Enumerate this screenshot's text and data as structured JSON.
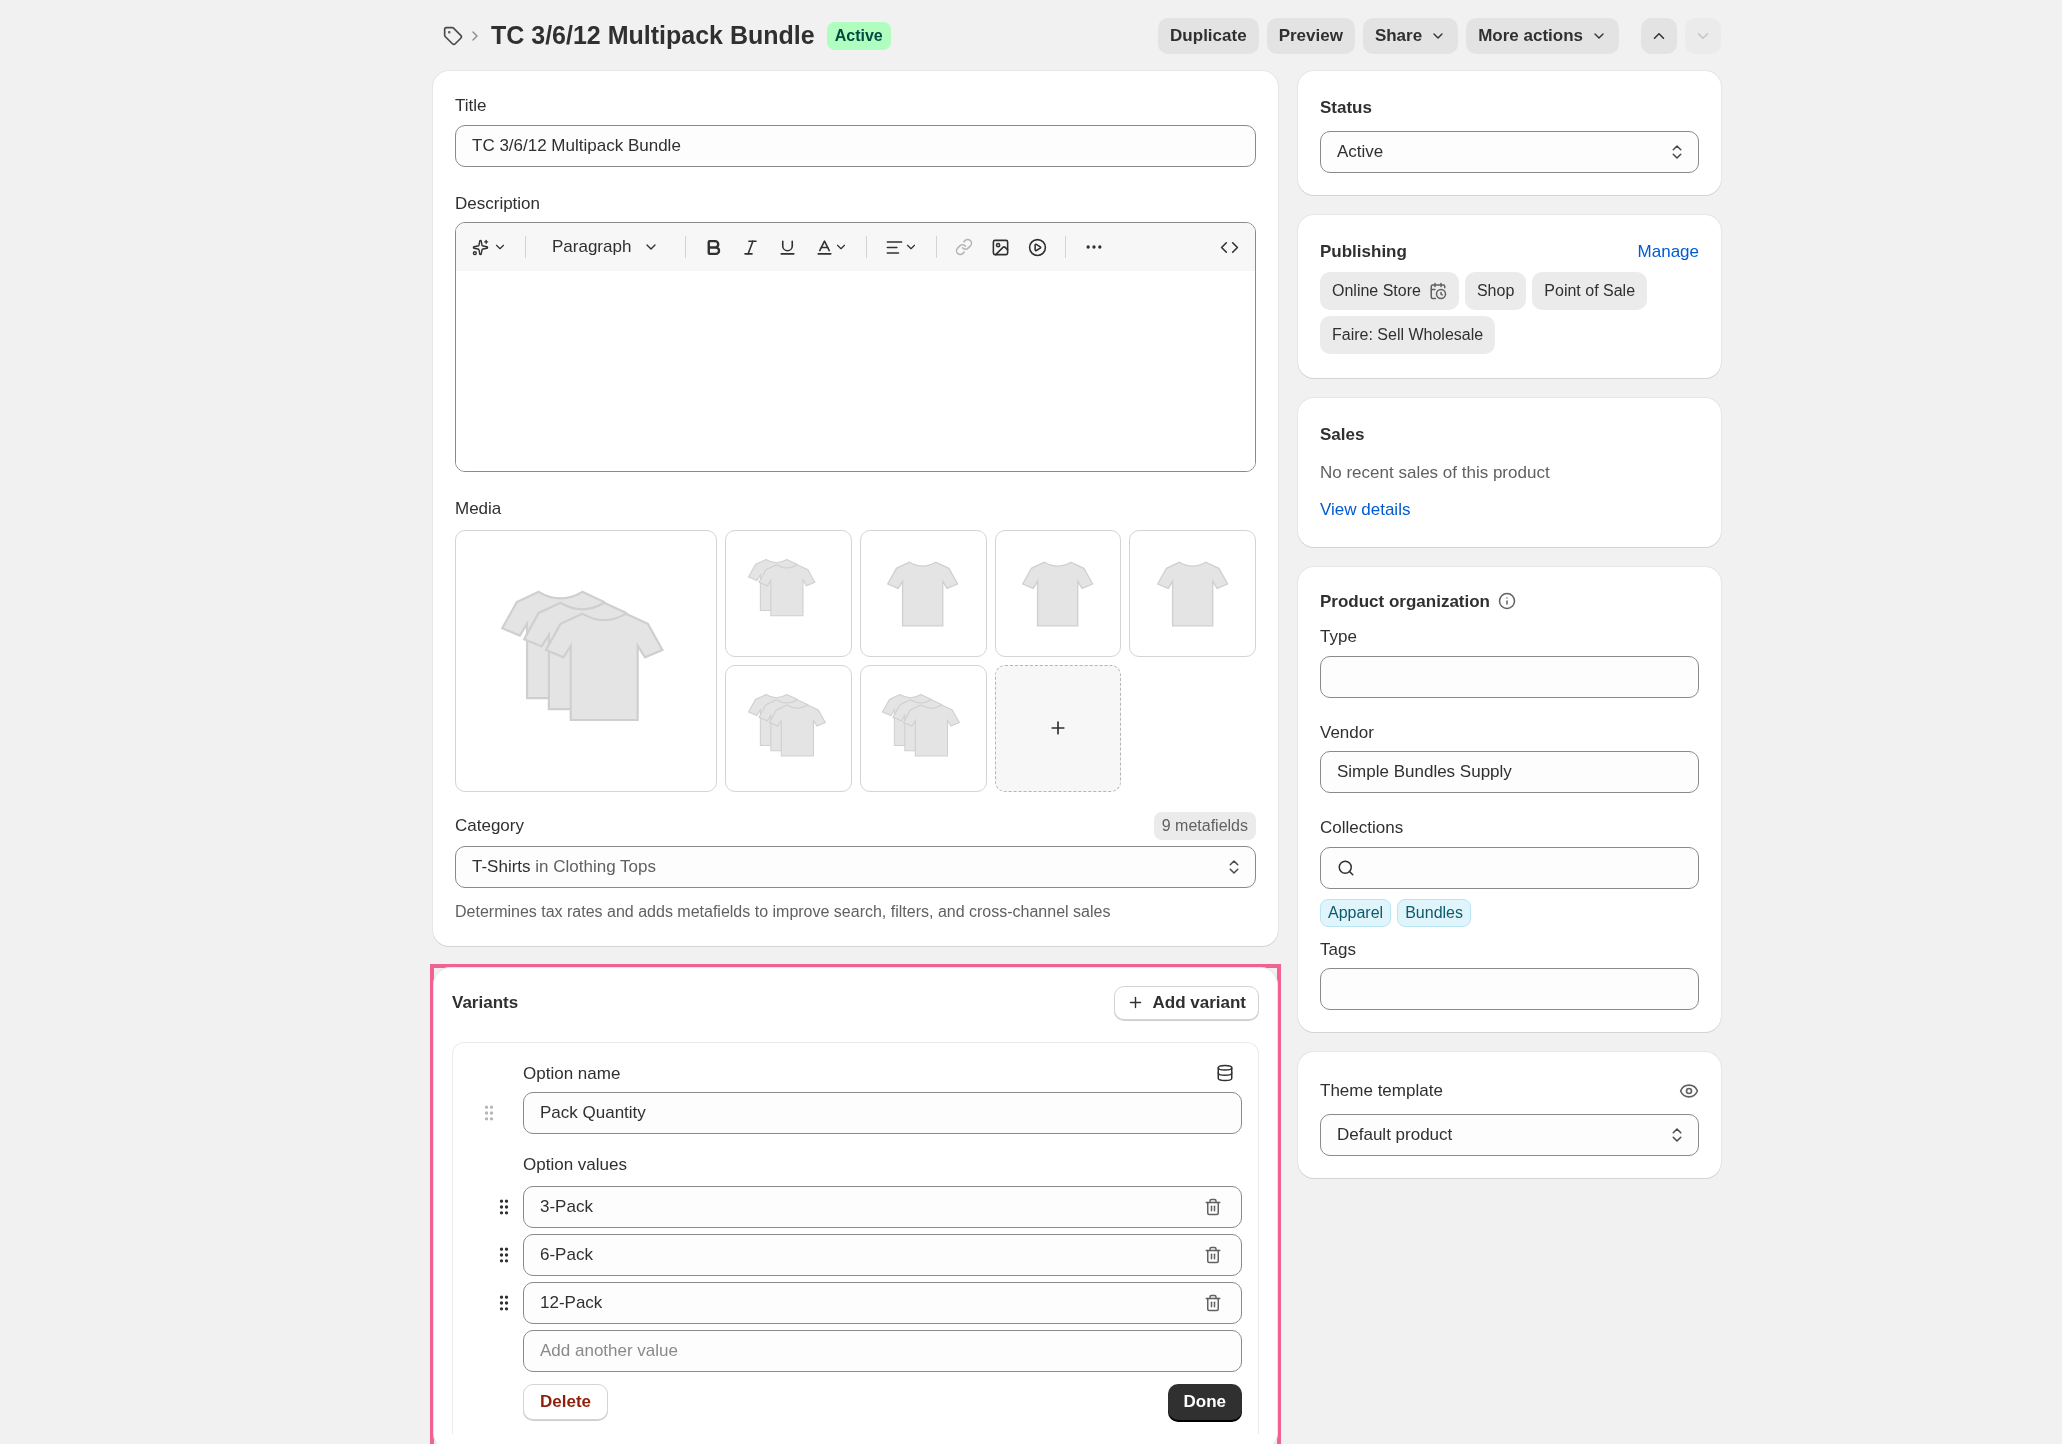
{
  "header": {
    "title": "TC 3/6/12 Multipack Bundle",
    "status": "Active",
    "actions": [
      {
        "label": "Duplicate",
        "kind": "plain"
      },
      {
        "label": "Preview",
        "kind": "plain"
      },
      {
        "label": "Share",
        "kind": "menu"
      },
      {
        "label": "More actions",
        "kind": "menu"
      }
    ],
    "nav": [
      {
        "disabled": false
      },
      {
        "disabled": true
      }
    ]
  },
  "product": {
    "title_label": "Title",
    "title_value": "TC 3/6/12 Multipack Bundle",
    "description_label": "Description",
    "paragraph_style": "Paragraph",
    "media_label": "Media",
    "category_label": "Category",
    "metafields": "9 metafields",
    "category_value": "T-Shirts",
    "category_path": "in Clothing Tops",
    "category_help": "Determines tax rates and adds metafields to improve search, filters, and cross-channel sales"
  },
  "variants": {
    "title": "Variants",
    "add_button": "Add variant",
    "option_name_label": "Option name",
    "option_name": "Pack Quantity",
    "option_values_label": "Option values",
    "values": [
      "3-Pack",
      "6-Pack",
      "12-Pack"
    ],
    "new_value_placeholder": "Add another value",
    "delete_button": "Delete",
    "done_button": "Done"
  },
  "status": {
    "label": "Status",
    "value": "Active"
  },
  "publishing": {
    "title": "Publishing",
    "manage": "Manage",
    "channels": [
      {
        "name": "Online Store",
        "scheduled": true
      },
      {
        "name": "Shop",
        "scheduled": false
      },
      {
        "name": "Point of Sale",
        "scheduled": false
      },
      {
        "name": "Faire: Sell Wholesale",
        "scheduled": false
      }
    ]
  },
  "sales": {
    "title": "Sales",
    "text": "No recent sales of this product",
    "link": "View details"
  },
  "organization": {
    "title": "Product organization",
    "type_label": "Type",
    "vendor_label": "Vendor",
    "vendor": "Simple Bundles Supply",
    "collections_label": "Collections",
    "collections": [
      "Apparel",
      "Bundles"
    ],
    "tags_label": "Tags"
  },
  "theme": {
    "label": "Theme template",
    "value": "Default product"
  }
}
